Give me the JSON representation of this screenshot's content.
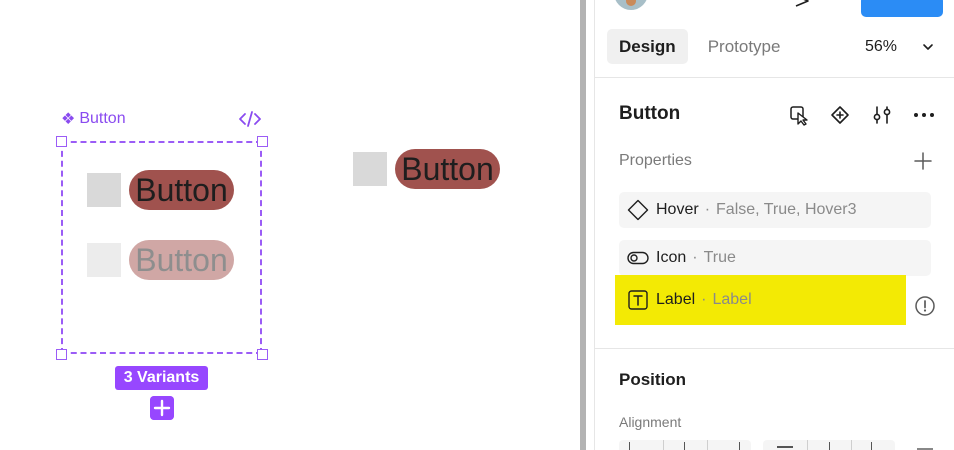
{
  "canvas": {
    "component_label": "Button",
    "component_glyph": "❖",
    "variants": [
      {
        "label": "Button",
        "state": "default"
      },
      {
        "label": "Button",
        "state": "disabled"
      }
    ],
    "instance_label": "Button",
    "variants_badge": "3 Variants"
  },
  "panel": {
    "tabs": {
      "design": "Design",
      "prototype": "Prototype"
    },
    "zoom": "56%",
    "component_title": "Button",
    "properties_title": "Properties",
    "properties": [
      {
        "name": "Hover",
        "dot": "·",
        "value": "False, True, Hover3",
        "icon": "variant-diamond-icon"
      },
      {
        "name": "Icon",
        "dot": "·",
        "value": "True",
        "icon": "boolean-toggle-icon"
      },
      {
        "name": "Label",
        "dot": "·",
        "value": "Label",
        "icon": "text-property-icon"
      }
    ],
    "position_title": "Position",
    "alignment_title": "Alignment"
  },
  "colors": {
    "accent": "#9747ff",
    "selection": "#9b5cf6",
    "button_fill": "#a0524e",
    "highlight": "#f3ea04",
    "share_blue": "#2b8cf5"
  }
}
